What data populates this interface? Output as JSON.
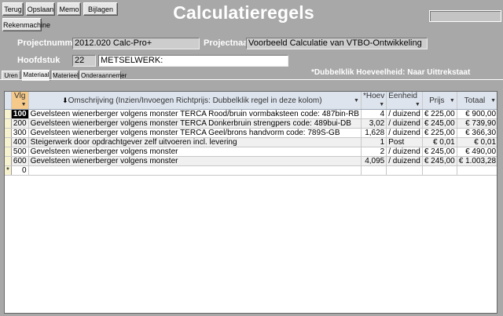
{
  "toolbar": {
    "terug": "Terug",
    "opslaan": "Opslaan",
    "memo": "Memo",
    "bijlagen": "Bijlagen",
    "rekenmachine": "Rekenmachine"
  },
  "title": "Calculatieregels",
  "header": {
    "projectnummer_label": "Projectnummer",
    "projectnummer_value": "2012.020 Calc-Pro+",
    "projectnaam_label": "Projectnaam",
    "projectnaam_value": "Voorbeeld Calculatie van VTBO-Ontwikkeling",
    "hoofdstuk_label": "Hoofdstuk",
    "hoofdstuk_nr": "22",
    "hoofdstuk_naam": "METSELWERK:"
  },
  "note": "*Dubbelklik Hoeveelheid: Naar Uittrekstaat",
  "tabs": [
    "Uren",
    "Materiaal",
    "Materieel",
    "Onderaannemer"
  ],
  "active_tab": "Materiaal",
  "grid": {
    "columns": [
      "Vlg",
      "Omschrijving (Inzien/Invoegen Richtprijs: Dubbelklik regel in deze kolom)",
      "*Hoev",
      "Eenheid",
      "Prijs",
      "Totaal"
    ],
    "rows": [
      {
        "vlg": "100",
        "omschrijving": "Gevelsteen wienerberger volgens monster TERCA Rood/bruin vormbaksteen code: 487bin-RB",
        "hoev": "4",
        "eenheid": "/ duizend",
        "prijs": "€ 225,00",
        "totaal": "€ 900,00"
      },
      {
        "vlg": "200",
        "omschrijving": "Gevelsteen wienerberger volgens monster TERCA Donkerbruin strengpers code: 489bui-DB",
        "hoev": "3,02",
        "eenheid": "/ duizend",
        "prijs": "€ 245,00",
        "totaal": "€ 739,90"
      },
      {
        "vlg": "300",
        "omschrijving": "Gevelsteen wienerberger volgens monster TERCA Geel/brons handvorm code: 789S-GB",
        "hoev": "1,628",
        "eenheid": "/ duizend",
        "prijs": "€ 225,00",
        "totaal": "€ 366,30"
      },
      {
        "vlg": "400",
        "omschrijving": "Steigerwerk door opdrachtgever zelf uitvoeren incl. levering",
        "hoev": "1",
        "eenheid": "Post",
        "prijs": "€ 0,01",
        "totaal": "€ 0,01"
      },
      {
        "vlg": "500",
        "omschrijving": "Gevelsteen wienerberger volgens monster",
        "hoev": "2",
        "eenheid": "/ duizend",
        "prijs": "€ 245,00",
        "totaal": "€ 490,00"
      },
      {
        "vlg": "600",
        "omschrijving": "Gevelsteen wienerberger volgens monster",
        "hoev": "4,095",
        "eenheid": "/ duizend",
        "prijs": "€ 245,00",
        "totaal": "€ 1.003,28"
      }
    ],
    "new_row": {
      "marker": "*",
      "vlg": "0"
    }
  }
}
